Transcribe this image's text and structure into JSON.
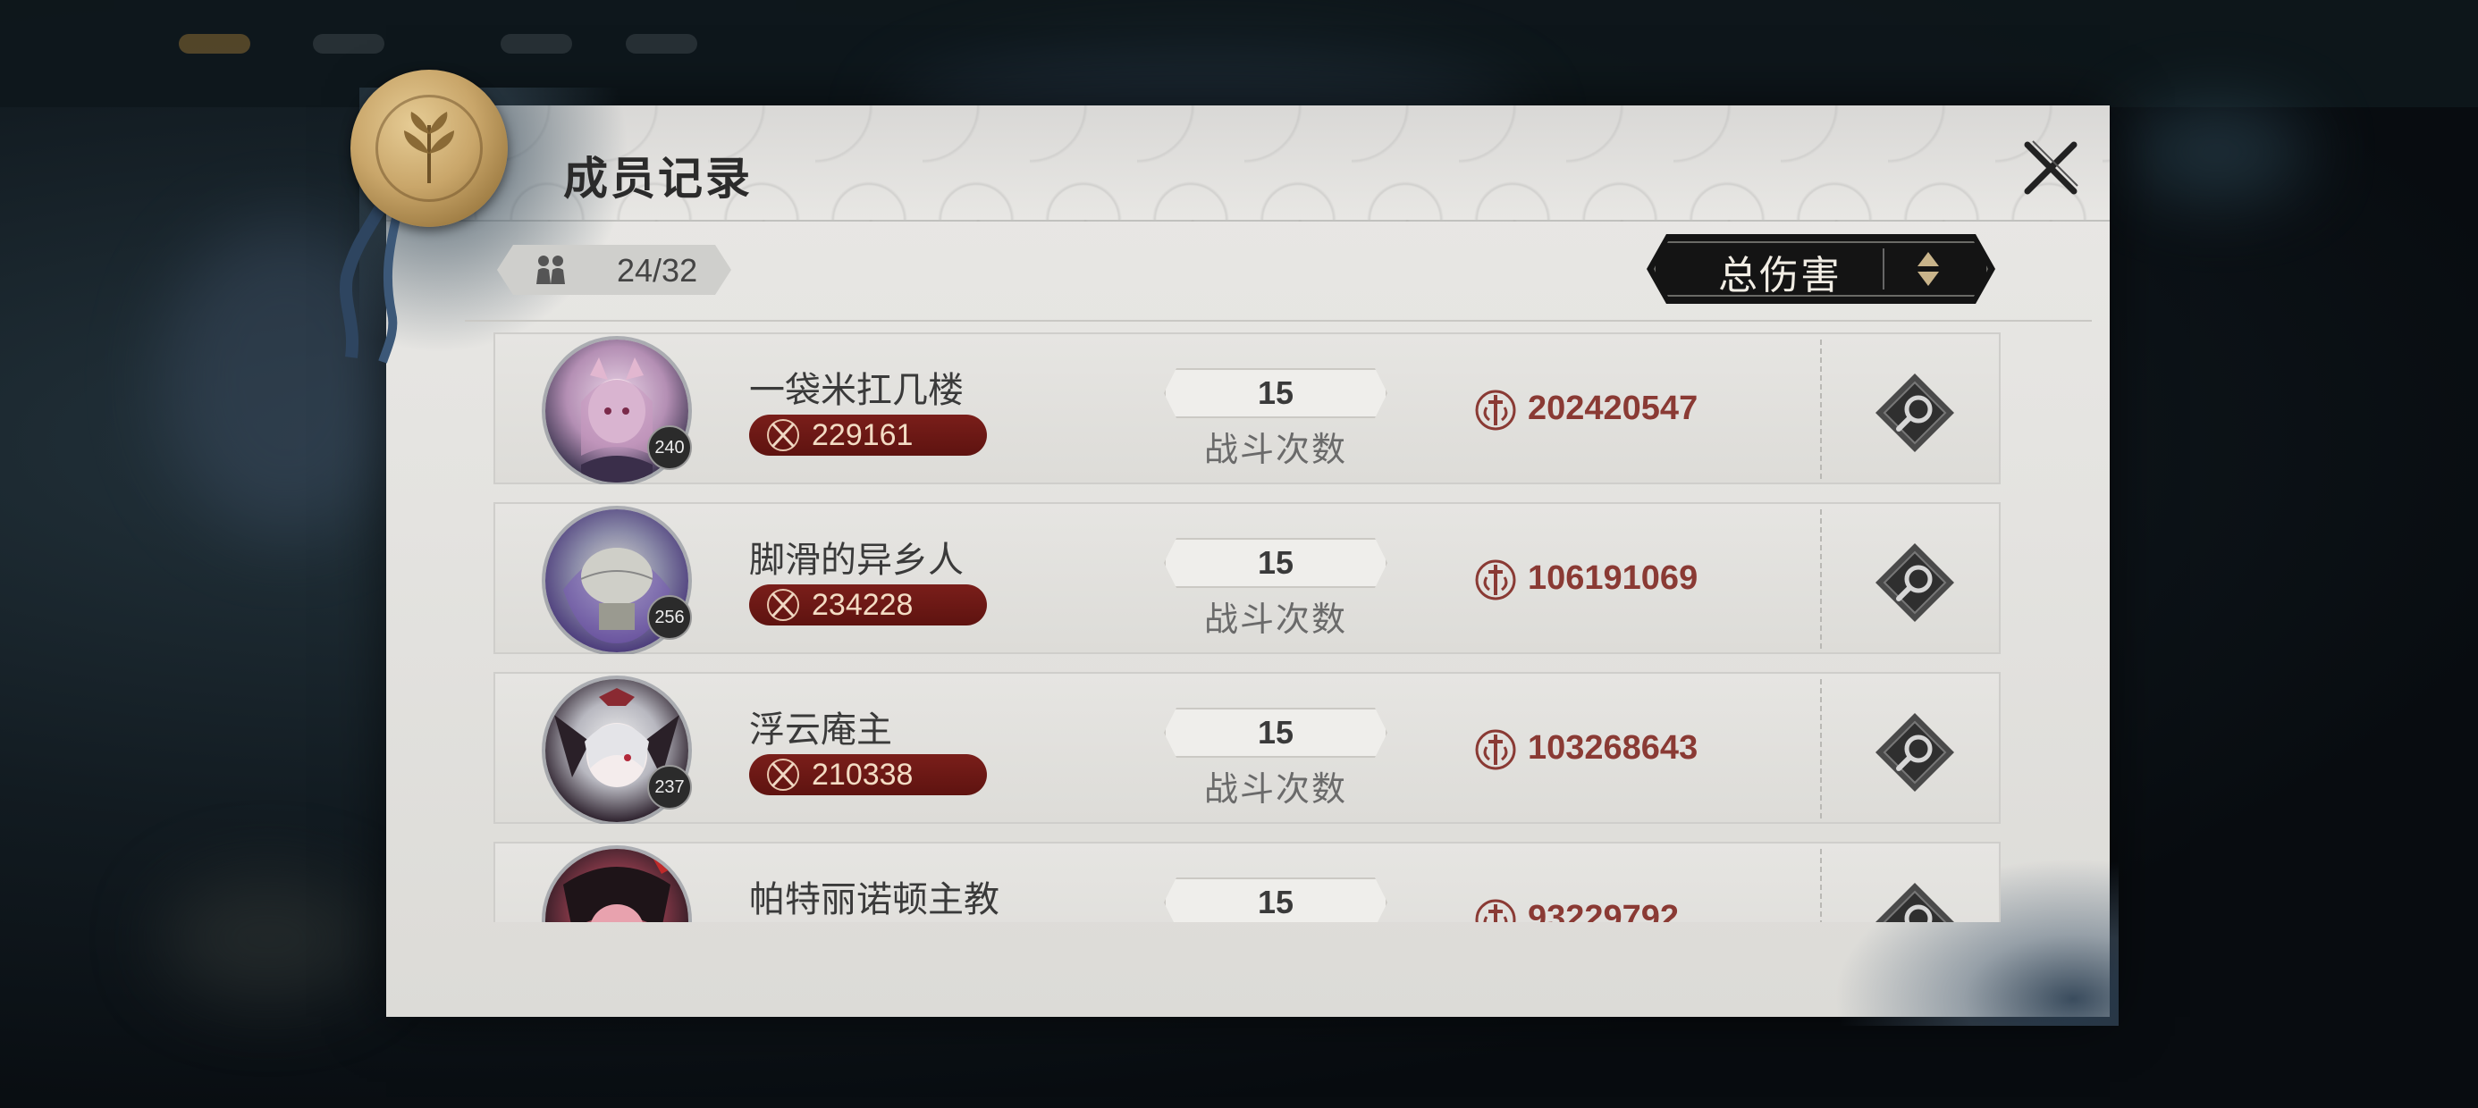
{
  "dialog": {
    "title": "成员记录",
    "member_count": "24/32",
    "sort_label": "总伤害"
  },
  "members": [
    {
      "name": "一袋米扛几楼",
      "level": "240",
      "power": "229161",
      "battles": "15",
      "battles_label": "战斗次数",
      "damage": "202420547"
    },
    {
      "name": "脚滑的异乡人",
      "level": "256",
      "power": "234228",
      "battles": "15",
      "battles_label": "战斗次数",
      "damage": "106191069"
    },
    {
      "name": "浮云庵主",
      "level": "237",
      "power": "210338",
      "battles": "15",
      "battles_label": "战斗次数",
      "damage": "103268643"
    },
    {
      "name": "帕特丽诺顿主教",
      "level": "",
      "power": "",
      "battles": "15",
      "battles_label": "",
      "damage": "93229792"
    }
  ],
  "icons": {
    "close": "close-icon",
    "members": "members-icon",
    "sort": "sort-arrows-icon",
    "power": "crossed-swords-icon",
    "damage": "sword-emblem-icon",
    "detail": "magnifier-icon"
  },
  "colors": {
    "accent_red": "#8a3a34",
    "power_pill": "#6e1a16",
    "panel": "#e5e4e1",
    "sort_button": "#141414"
  }
}
